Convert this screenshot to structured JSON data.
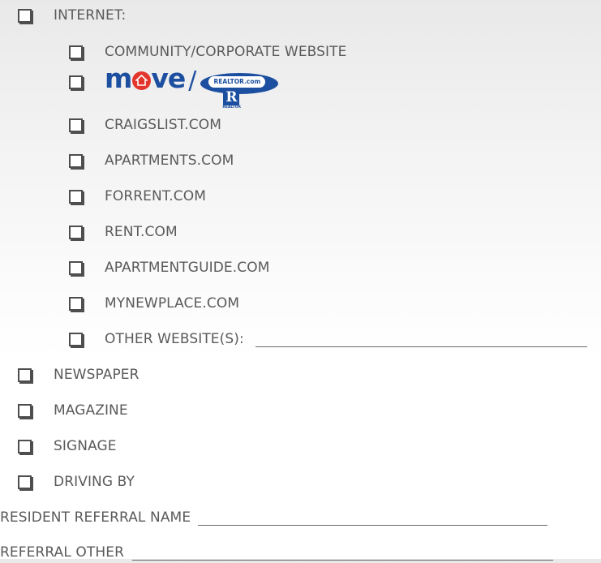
{
  "internet": {
    "label": "INTERNET:",
    "items": [
      {
        "label": "COMMUNITY/CORPORATE WEBSITE"
      },
      {
        "label": "CRAIGSLIST.COM"
      },
      {
        "label": "APARTMENTS.COM"
      },
      {
        "label": "FORRENT.COM"
      },
      {
        "label": "RENT.COM"
      },
      {
        "label": "APARTMENTGUIDE.COM"
      },
      {
        "label": "MYNEWPLACE.COM"
      },
      {
        "label": "OTHER WEBSITE(S):"
      }
    ],
    "logo_option": {
      "move_logo_text": "move",
      "separator": "/",
      "realtor_logo_text": "REALTOR.com",
      "realtor_mark": "R",
      "realtor_mark_caption": "REALTOR"
    }
  },
  "sources": [
    {
      "label": "NEWSPAPER"
    },
    {
      "label": "MAGAZINE"
    },
    {
      "label": "SIGNAGE"
    },
    {
      "label": "DRIVING BY"
    }
  ],
  "fields": {
    "resident_referral_label": "RESIDENT REFERRAL NAME",
    "referral_other_label": "REFERRAL OTHER"
  },
  "colors": {
    "text": "#5a5a5a",
    "checkbox_border": "#4e4e4e",
    "move_blue": "#1d4fa0",
    "move_red": "#e2362c"
  },
  "icons": {
    "checkbox": "checkbox-icon",
    "move_house": "house-icon",
    "realtor": "realtor-logo"
  }
}
